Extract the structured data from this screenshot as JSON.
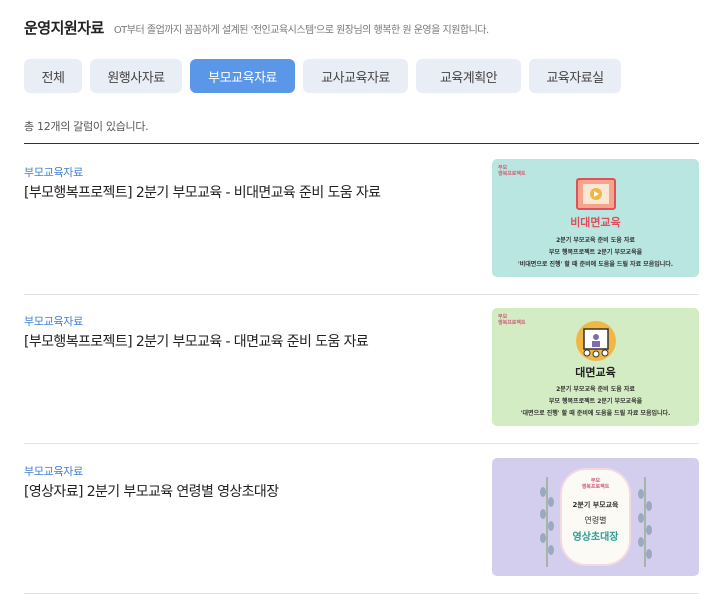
{
  "header": {
    "title": "운영지원자료",
    "subtitle": "OT부터 졸업까지 꼼꼼하게 설계된 '전인교육시스템'으로 원장님의 행복한 원 운영을 지원합니다."
  },
  "tabs": [
    {
      "label": "전체",
      "active": false
    },
    {
      "label": "원행사자료",
      "active": false
    },
    {
      "label": "부모교육자료",
      "active": true
    },
    {
      "label": "교사교육자료",
      "active": false
    },
    {
      "label": "교육계획안",
      "active": false
    },
    {
      "label": "교육자료실",
      "active": false
    }
  ],
  "count_text": "총 12개의 갈럼이 있습니다.",
  "items": [
    {
      "category": "부모교육자료",
      "title": "[부모행복프로젝트] 2분기 부모교육 - 비대면교육 준비 도움 자료",
      "thumb": {
        "bg": "#b9e6e0",
        "logo_line1": "부모",
        "logo_line2": "행복프로젝트",
        "heading": "비대면교육",
        "heading_color": "#e0505a",
        "lines": [
          "2분기 부모교육 준비 도움 자료",
          "부모 행복프로젝트 2분기 부모교육을",
          "'비대면으로 진행' 할 때 준비에 도움을 드릴 자료 모음입니다."
        ],
        "icon": "video-play-icon"
      }
    },
    {
      "category": "부모교육자료",
      "title": "[부모행복프로젝트] 2분기 부모교육 - 대면교육 준비 도움 자료",
      "thumb": {
        "bg": "#d4ecc3",
        "logo_line1": "부모",
        "logo_line2": "행복프로젝트",
        "heading": "대면교육",
        "heading_color": "#222222",
        "lines": [
          "2분기 부모교육 준비 도움 자료",
          "부모 행복프로젝트 2분기 부모교육을",
          "'대면으로 진행' 할 때 준비에 도움을 드릴 자료 모음입니다."
        ],
        "icon": "presentation-icon"
      }
    },
    {
      "category": "부모교육자료",
      "title": "[영상자료] 2분기 부모교육 연령별 영상초대장",
      "thumb": {
        "bg": "#d3cdee",
        "logo_line1": "부모",
        "logo_line2": "행복프로젝트",
        "line_a": "2분기 부모교육",
        "line_b": "연령별",
        "line_c": "영상초대장",
        "icon": "lavender-sprig-icon"
      }
    }
  ],
  "colors": {
    "accent": "#5b97e8",
    "category": "#3f7fd6",
    "tab_bg": "#e9edf5"
  }
}
